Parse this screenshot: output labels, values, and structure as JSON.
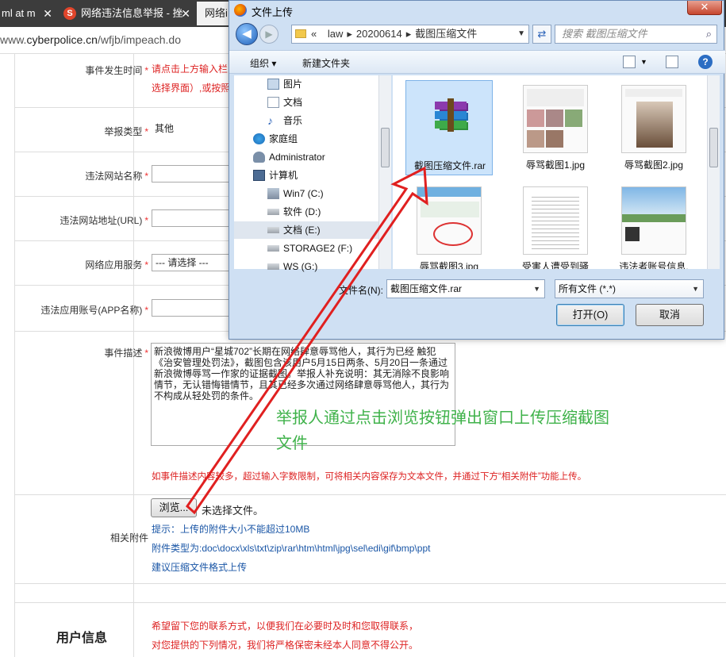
{
  "browser": {
    "tabs": [
      {
        "label": "ml at m",
        "close": "✕"
      },
      {
        "label": "网络违法信息举报 - 挫",
        "close": "✕",
        "favicon": "S"
      },
      {
        "label": "网络i"
      }
    ],
    "url_prefix": "www.",
    "url_host": "cyberpolice.cn",
    "url_path": "/wfjb/impeach.do"
  },
  "form": {
    "event_time": {
      "label": "事件发生时间",
      "req": "*",
      "hint_line1": "请点击上方输入栏",
      "hint_line2": "选择界面）,或按照"
    },
    "report_type": {
      "label": "举报类型",
      "req": "*",
      "value": "其他"
    },
    "site_name": {
      "label": "违法网站名称",
      "req": "*"
    },
    "site_url": {
      "label": "违法网站地址(URL)",
      "req": "*"
    },
    "app_service": {
      "label": "网络应用服务",
      "req": "*",
      "value": "--- 请选择 ---"
    },
    "app_account": {
      "label": "违法应用账号(APP名称)",
      "req": "*"
    },
    "description": {
      "label": "事件描述",
      "req": "*",
      "text": "新浪微博用户“星城702”长期在网络肆意辱骂他人，其行为已经 触犯《治安管理处罚法》，截图包含该用户5月15日两条、5月20日一条通过新浪微博辱骂一作家的证据截图。举报人补充说明：其无消除不良影响情节，无认错悔错情节，且其已经多次通过网络肆意辱骂他人，其行为不构成从轻处罚的条件。",
      "limit_note": "如事件描述内容较多，超过输入字数限制，可将相关内容保存为文本文件，并通过下方“相关附件”功能上传。"
    },
    "attachment": {
      "label": "相关附件",
      "browse": "浏览...",
      "no_file": "未选择文件。",
      "size_note": "提示：上传的附件大小不能超过10MB",
      "types_note": "附件类型为:doc\\docx\\xls\\txt\\zip\\rar\\htm\\html\\jpg\\sel\\edi\\gif\\bmp\\ppt",
      "suggest": "建议压缩文件格式上传"
    },
    "user_info": {
      "title": "用户信息",
      "note1": "希望留下您的联系方式，以便我们在必要时及时和您取得联系，",
      "note2": "对您提供的下列情况，我们将严格保密未经本人同意不得公开。"
    }
  },
  "annotation": {
    "line1": "举报人通过点击浏览按钮弹出窗口上传压缩截图",
    "line2": "文件",
    "arrow_color": "#e02020"
  },
  "dialog": {
    "title": "文件上传",
    "close": "✕",
    "path": [
      "«",
      "law",
      "20200614",
      "截图压缩文件"
    ],
    "search_placeholder": "搜索 截图压缩文件",
    "organize": "组织 ▾",
    "new_folder": "新建文件夹",
    "nav_items": [
      {
        "label": "图片",
        "icon": "pictures-icon"
      },
      {
        "label": "文档",
        "icon": "documents-icon"
      },
      {
        "label": "音乐",
        "icon": "music-icon"
      },
      {
        "label": "家庭组",
        "icon": "homegroup-icon"
      },
      {
        "label": "Administrator",
        "icon": "user-icon"
      },
      {
        "label": "计算机",
        "icon": "computer-icon"
      },
      {
        "label": "Win7 (C:)",
        "icon": "system-drive-icon"
      },
      {
        "label": "软件 (D:)",
        "icon": "drive-icon"
      },
      {
        "label": "文档 (E:)",
        "icon": "drive-icon"
      },
      {
        "label": "STORAGE2 (F:)",
        "icon": "drive-icon"
      },
      {
        "label": "WS (G:)",
        "icon": "drive-icon"
      }
    ],
    "files": [
      {
        "name": "截图压缩文件.rar",
        "icon": "winrar-archive-icon"
      },
      {
        "name": "辱骂截图1.jpg"
      },
      {
        "name": "辱骂截图2.jpg"
      },
      {
        "name": "辱骂截图3.jpg"
      },
      {
        "name": "受害人遭受到骚"
      },
      {
        "name": "违法者账号信息."
      }
    ],
    "filename_label": "文件名(N):",
    "filename_value": "截图压缩文件.rar",
    "filetype_value": "所有文件 (*.*)",
    "open": "打开(O)",
    "cancel": "取消"
  }
}
